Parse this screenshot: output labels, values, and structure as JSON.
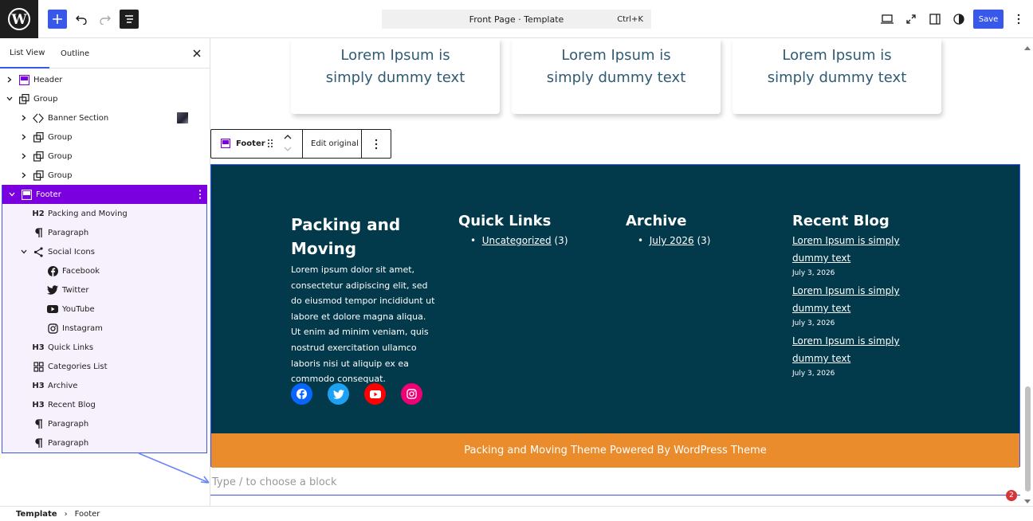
{
  "topbar": {
    "doc_title": "Front Page · Template",
    "shortcut": "Ctrl+K",
    "save_label": "Save",
    "icons": [
      "wordpress-logo",
      "plus-icon",
      "undo-icon",
      "redo-icon",
      "document-overview-icon",
      "desktop-icon",
      "expand-icon",
      "sidebar-icon",
      "styles-icon",
      "more-vertical-icon"
    ]
  },
  "sidebar": {
    "tabs": [
      "List View",
      "Outline"
    ],
    "tree": [
      {
        "label": "Header",
        "level": 0,
        "icon": "template-part-icon",
        "expanded": false
      },
      {
        "label": "Group",
        "level": 0,
        "icon": "group-icon",
        "expanded": true
      },
      {
        "label": "Banner Section",
        "level": 1,
        "icon": "cover-icon",
        "expanded": false
      },
      {
        "label": "Group",
        "level": 1,
        "icon": "group-icon",
        "expanded": false
      },
      {
        "label": "Group",
        "level": 1,
        "icon": "group-icon",
        "expanded": false
      },
      {
        "label": "Group",
        "level": 1,
        "icon": "group-icon",
        "expanded": false
      },
      {
        "label": "Footer",
        "level": 0,
        "icon": "template-part-icon",
        "expanded": true,
        "selected": true
      },
      {
        "label": "Packing and Moving",
        "level": 1,
        "icon": "H2"
      },
      {
        "label": "Paragraph",
        "level": 1,
        "icon": "paragraph-icon"
      },
      {
        "label": "Social Icons",
        "level": 1,
        "icon": "share-icon",
        "expanded": true
      },
      {
        "label": "Facebook",
        "level": 2,
        "icon": "facebook-icon"
      },
      {
        "label": "Twitter",
        "level": 2,
        "icon": "twitter-icon"
      },
      {
        "label": "YouTube",
        "level": 2,
        "icon": "youtube-icon"
      },
      {
        "label": "Instagram",
        "level": 2,
        "icon": "instagram-icon"
      },
      {
        "label": "Quick Links",
        "level": 1,
        "icon": "H3"
      },
      {
        "label": "Categories List",
        "level": 1,
        "icon": "categories-icon"
      },
      {
        "label": "Archive",
        "level": 1,
        "icon": "H3"
      },
      {
        "label": "Recent Blog",
        "level": 1,
        "icon": "H3"
      },
      {
        "label": "Paragraph",
        "level": 1,
        "icon": "paragraph-icon"
      },
      {
        "label": "Paragraph",
        "level": 1,
        "icon": "paragraph-icon"
      }
    ]
  },
  "canvas": {
    "cards": [
      "Lorem Ipsum is simply dummy text",
      "Lorem Ipsum is simply dummy text",
      "Lorem Ipsum is simply dummy text"
    ],
    "toolbar": {
      "block": "Footer",
      "edit": "Edit original"
    },
    "footer": {
      "about_title": "Packing and Moving",
      "about_text": "Lorem ipsum dolor sit amet, consectetur adipiscing elit, sed do eiusmod tempor incididunt ut labore et dolore magna aliqua. Ut enim ad minim veniam, quis nostrud exercitation ullamco laboris nisi ut aliquip ex ea commodo consequat.",
      "quick_title": "Quick Links",
      "quick_link": "Uncategorized",
      "quick_count": "(3)",
      "archive_title": "Archive",
      "archive_link": "July 2026",
      "archive_count": "(3)",
      "blog_title": "Recent Blog",
      "posts": [
        {
          "title": "Lorem Ipsum is simply dummy text",
          "date": "July 3, 2026"
        },
        {
          "title": "Lorem Ipsum is simply dummy text",
          "date": "July 3, 2026"
        },
        {
          "title": "Lorem Ipsum is simply dummy text",
          "date": "July 3, 2026"
        }
      ],
      "copyright": "Packing and Moving Theme Powered By WordPress Theme",
      "social_colors": {
        "facebook": "#0866ff",
        "twitter": "#1da1f2",
        "youtube": "#ff0000",
        "instagram": "#f00075"
      }
    },
    "placeholder": "Type / to choose a block"
  },
  "breadcrumb": [
    "Template",
    "Footer"
  ],
  "notification_count": "2",
  "colors": {
    "accent": "#3858e9",
    "selected": "#7a00df",
    "footer_bg": "#023a4b",
    "bar_bg": "#ea8c2c"
  }
}
